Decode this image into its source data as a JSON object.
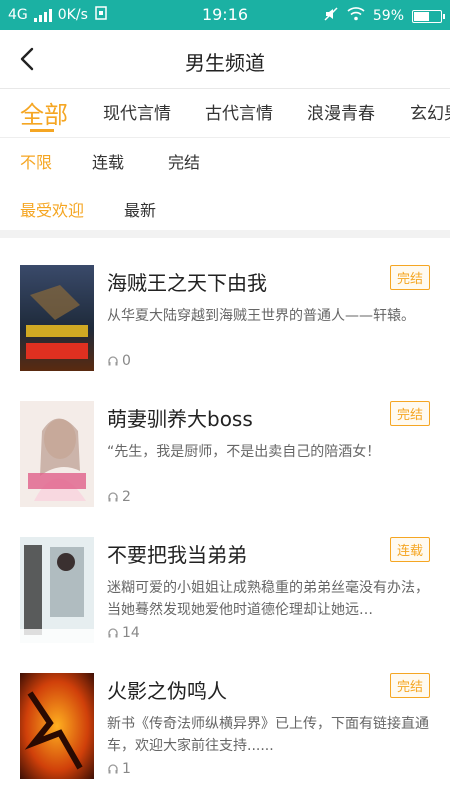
{
  "status_bar": {
    "network": "4G",
    "speed": "0K/s",
    "time": "19:16",
    "battery": "59%",
    "battery_level": 0.59
  },
  "header": {
    "title": "男生频道"
  },
  "categories": [
    "全部",
    "现代言情",
    "古代言情",
    "浪漫青春",
    "玄幻男"
  ],
  "status_filters": [
    "不限",
    "连载",
    "完结"
  ],
  "sort_filters": [
    "最受欢迎",
    "最新"
  ],
  "books": [
    {
      "title": "海贼王之天下由我",
      "status": "完结",
      "description": "从华夏大陆穿越到海贼王世界的普通人——轩辕。",
      "plays": "0"
    },
    {
      "title": "萌妻驯养大boss",
      "status": "完结",
      "description": "“先生，我是厨师，不是出卖自己的陪酒女！",
      "plays": "2"
    },
    {
      "title": "不要把我当弟弟",
      "status": "连载",
      "description": "迷糊可爱的小姐姐让成熟稳重的弟弟丝毫没有办法，当她蓦然发现她爱他时道德伦理却让她远…",
      "plays": "14"
    },
    {
      "title": "火影之伪鸣人",
      "status": "完结",
      "description": "新书《传奇法师纵横异界》已上传，下面有链接直通车，欢迎大家前往支持......",
      "plays": "1"
    }
  ]
}
